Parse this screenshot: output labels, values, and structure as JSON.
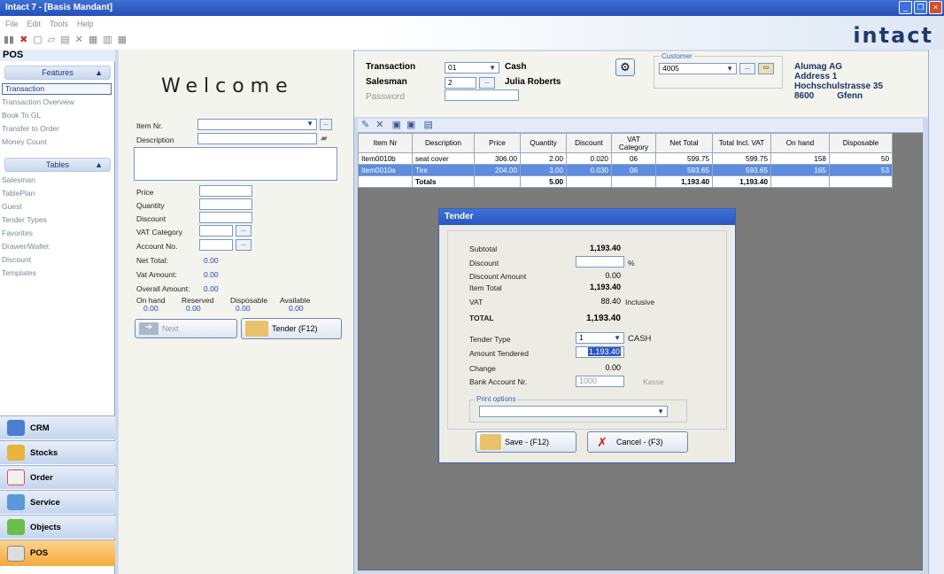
{
  "window": {
    "title": "Intact 7 - [Basis Mandant]"
  },
  "menu": [
    "File",
    "Edit",
    "Tools",
    "Help"
  ],
  "logo": "intact",
  "left": {
    "pos_title": "POS",
    "features_header": "Features",
    "features": [
      "Transaction",
      "Transaction Overview",
      "Book To GL",
      "Transfer to Order",
      "Money Count"
    ],
    "tables_header": "Tables",
    "tables": [
      "Salesman",
      "TablePlan",
      "Guest",
      "Tender Types",
      "Favorites",
      "Drawer/Wallet",
      "Discount",
      "Templates"
    ],
    "bottom_nav": [
      "CRM",
      "Stocks",
      "Order",
      "Service",
      "Objects",
      "POS"
    ]
  },
  "welcome": {
    "title": "Welcome",
    "item_nr_label": "Item Nr.",
    "description_label": "Description",
    "price_label": "Price",
    "quantity_label": "Quantity",
    "discount_label": "Discount",
    "vat_category_label": "VAT Category",
    "account_no_label": "Account No.",
    "net_total_label": "Net Total:",
    "net_total": "0.00",
    "vat_amount_label": "Vat Amount:",
    "vat_amount": "0.00",
    "overall_amount_label": "Overall Amount:",
    "overall_amount": "0.00",
    "stock_labels": [
      "On hand",
      "Reserved",
      "Disposable",
      "Available"
    ],
    "stock_values": [
      "0.00",
      "0.00",
      "0.00",
      "0.00"
    ],
    "next_button": "Next",
    "tender_button": "Tender (F12)"
  },
  "header": {
    "transaction_label": "Transaction",
    "transaction_value": "01",
    "transaction_name": "Cash",
    "salesman_label": "Salesman",
    "salesman_value": "2",
    "salesman_name": "Julia Roberts",
    "password_label": "Password",
    "customer_label": "Customer",
    "customer_value": "4005",
    "customer_name": "Alumag AG",
    "customer_address1": "Address 1",
    "customer_street": "Hochschulstrasse 35",
    "customer_zip": "8600",
    "customer_city": "Gfenn"
  },
  "grid": {
    "columns": [
      "Item Nr",
      "Description",
      "Price",
      "Quantity",
      "Discount",
      "VAT Category",
      "Net Total",
      "Total Incl. VAT",
      "On hand",
      "Disposable"
    ],
    "rows": [
      [
        "Item0010b",
        "seat cover",
        "306.00",
        "2.00",
        "0.020",
        "06",
        "599.75",
        "599.75",
        "158",
        "50"
      ],
      [
        "Item0010a",
        "Tire",
        "204.00",
        "3.00",
        "0.030",
        "06",
        "593.65",
        "593.65",
        "165",
        "53"
      ]
    ],
    "totals_label": "Totals",
    "totals_quantity": "5.00",
    "totals_net": "1,193.40",
    "totals_incl": "1,193.40"
  },
  "tender": {
    "title": "Tender",
    "subtotal_label": "Subtotal",
    "subtotal": "1,193.40",
    "discount_label": "Discount",
    "discount_unit": "%",
    "discount_amount_label": "Discount Amount",
    "discount_amount": "0.00",
    "item_total_label": "Item Total",
    "item_total": "1,193.40",
    "vat_label": "VAT",
    "vat": "88.40",
    "vat_mode": "Inclusive",
    "total_label": "TOTAL",
    "total": "1,193.40",
    "tender_type_label": "Tender Type",
    "tender_type_value": "1",
    "tender_type_name": "CASH",
    "amount_tendered_label": "Amount Tendered",
    "amount_tendered": "1,193.40",
    "change_label": "Change",
    "change": "0.00",
    "bank_account_label": "Bank Account Nr.",
    "bank_account": "1000",
    "bank_account_name": "Kasse",
    "print_options_label": "Print options",
    "save_button": "Save - (F12)",
    "cancel_button": "Cancel - (F3)"
  }
}
